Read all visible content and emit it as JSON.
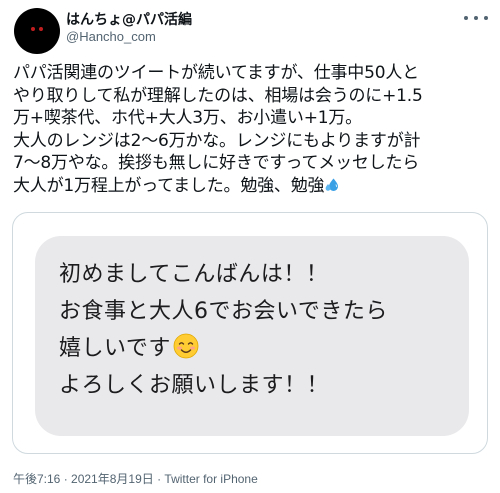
{
  "author": {
    "display_name": "はんちょ@パパ活編",
    "handle": "@Hancho_com",
    "avatar_icon": "dark-avatar-icon"
  },
  "tweet": {
    "lines": [
      "パパ活関連のツイートが続いてますが、仕事中50人と",
      "やり取りして私が理解したのは、相場は会うのに+1.5",
      "万+喫茶代、ホ代+大人3万、お小遣い+1万。",
      "大人のレンジは2〜6万かな。レンジにもよりますが計",
      "7〜8万やな。挨拶も無しに好きですってメッセしたら",
      "大人が1万程上がってました。勉強、勉強"
    ],
    "trailing_emoji": "sweat-droplets-icon"
  },
  "image": {
    "lines": [
      "初めましてこんばんは！！",
      "お食事と大人6でお会いできたら",
      "嬉しいです",
      "よろしくお願いします！！"
    ],
    "inline_emoji": "smiling-face-icon",
    "bubble_color": "#e9e9eb"
  },
  "meta": {
    "timestamp": "午後7:16 · 2021年8月19日 · Twitter for iPhone"
  },
  "colors": {
    "text": "#0f1419",
    "secondary": "#536471",
    "border": "#cfd9de"
  }
}
